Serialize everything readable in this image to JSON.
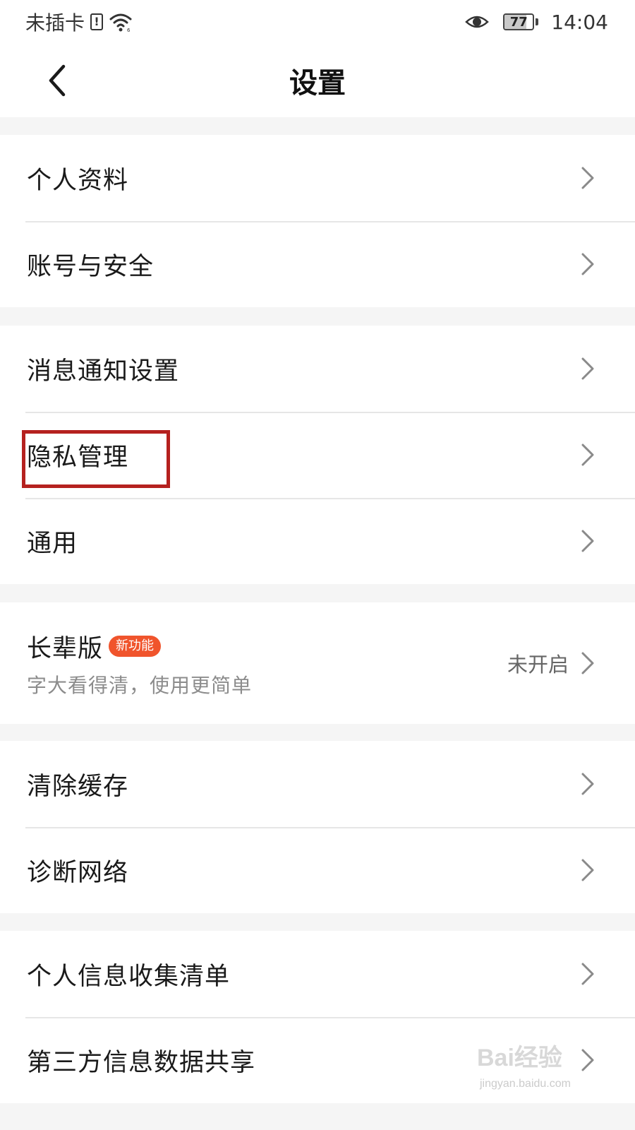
{
  "status_bar": {
    "carrier": "未插卡",
    "sim_icon": "sim-alert-icon",
    "wifi_icon": "wifi-icon",
    "eye_icon": "eye-icon",
    "battery_level": "77",
    "battery_fraction": 0.77,
    "time": "14:04"
  },
  "header": {
    "back_icon": "chevron-left-icon",
    "title": "设置"
  },
  "sections": {
    "account": [
      {
        "label": "个人资料"
      },
      {
        "label": "账号与安全"
      }
    ],
    "preferences": [
      {
        "label": "消息通知设置"
      },
      {
        "label": "隐私管理"
      },
      {
        "label": "通用"
      }
    ],
    "elder_mode": {
      "title": "长辈版",
      "badge": "新功能",
      "subtitle": "字大看得清，使用更简单",
      "value": "未开启"
    },
    "tools": [
      {
        "label": "清除缓存"
      },
      {
        "label": "诊断网络"
      }
    ],
    "info": [
      {
        "label": "个人信息收集清单"
      },
      {
        "label": "第三方信息数据共享"
      }
    ]
  },
  "colors": {
    "badge": "#f0542c",
    "highlight": "#b5211f",
    "background": "#f5f5f5"
  },
  "watermark": {
    "brand": "Bai经验",
    "url": "jingyan.baidu.com"
  }
}
